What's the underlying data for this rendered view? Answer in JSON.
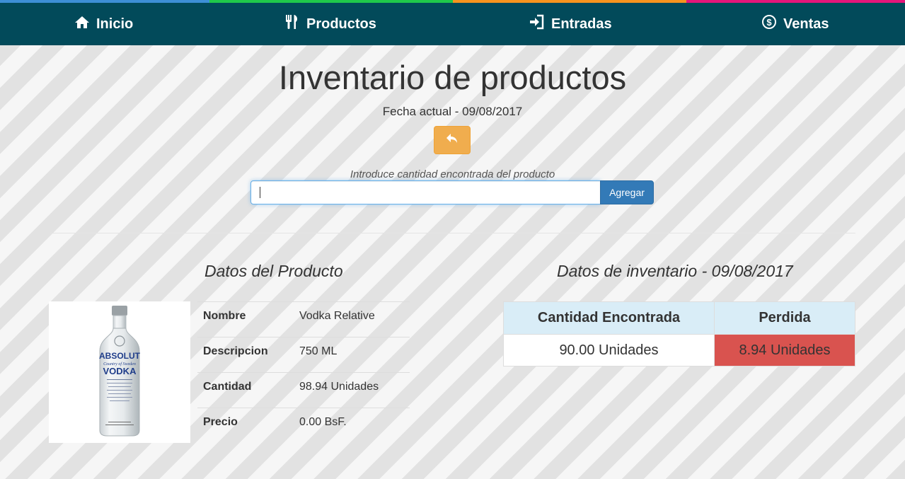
{
  "colors": {
    "strip": [
      "#3d8fd6",
      "#1fc84a",
      "#f7931e",
      "#e6157a"
    ],
    "navbar": "#024a5a",
    "warning": "#f0ad4e",
    "primary": "#337ab7",
    "danger": "#d9534f",
    "info": "#d9edf7"
  },
  "nav": {
    "items": [
      {
        "label": "Inicio",
        "icon": "home-icon"
      },
      {
        "label": "Productos",
        "icon": "fork-knife-icon"
      },
      {
        "label": "Entradas",
        "icon": "sign-in-icon"
      },
      {
        "label": "Ventas",
        "icon": "dollar-circle-icon"
      }
    ]
  },
  "header": {
    "title": "Inventario de productos",
    "date_line": "Fecha actual - 09/08/2017",
    "back_icon": "undo-arrow-icon"
  },
  "form": {
    "label": "Introduce cantidad encontrada del producto",
    "value": "",
    "button_label": "Agregar"
  },
  "product": {
    "section_title": "Datos del Producto",
    "image_icon": "vodka-bottle-image",
    "rows": [
      {
        "key": "Nombre",
        "value": "Vodka Relative"
      },
      {
        "key": "Descripcion",
        "value": "750 ML"
      },
      {
        "key": "Cantidad",
        "value": "98.94 Unidades"
      },
      {
        "key": "Precio",
        "value": "0.00 BsF."
      }
    ]
  },
  "inventory": {
    "section_title": "Datos de inventario - 09/08/2017",
    "headers": [
      "Cantidad Encontrada",
      "Perdida"
    ],
    "found": "90.00 Unidades",
    "loss": "8.94 Unidades"
  }
}
